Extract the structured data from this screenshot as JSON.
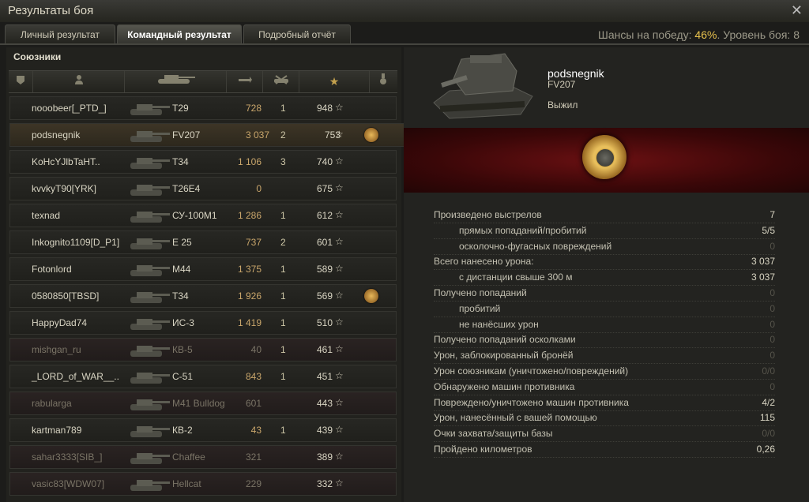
{
  "window": {
    "title": "Результаты боя"
  },
  "tabs": [
    {
      "label": "Личный результат"
    },
    {
      "label": "Командный результат"
    },
    {
      "label": "Подробный отчёт"
    }
  ],
  "header": {
    "chances_label": "Шансы на победу:",
    "chances_value": "46%",
    "level_label": ". Уровень боя: 8"
  },
  "team": {
    "title": "Союзники",
    "rows": [
      {
        "name": "nooobeer[_PTD_]",
        "vehicle": "T29",
        "damage": "728",
        "kills": "1",
        "xp": "948",
        "medal": false,
        "state": "alive"
      },
      {
        "name": "podsnegnik",
        "vehicle": "FV207",
        "damage": "3 037",
        "kills": "2",
        "xp": "753",
        "medal": true,
        "state": "me"
      },
      {
        "name": "KoHcYJlbTaHT..",
        "vehicle": "T34",
        "damage": "1 106",
        "kills": "3",
        "xp": "740",
        "medal": false,
        "state": "alive"
      },
      {
        "name": "kvvkyT90[YRK]",
        "vehicle": "T26E4",
        "damage": "0",
        "kills": "",
        "xp": "675",
        "medal": false,
        "state": "alive"
      },
      {
        "name": "texnad",
        "vehicle": "СУ-100М1",
        "damage": "1 286",
        "kills": "1",
        "xp": "612",
        "medal": false,
        "state": "alive"
      },
      {
        "name": "Inkognito1109[D_P1]",
        "vehicle": "E 25",
        "damage": "737",
        "kills": "2",
        "xp": "601",
        "medal": false,
        "state": "alive"
      },
      {
        "name": "Fotonlord",
        "vehicle": "M44",
        "damage": "1 375",
        "kills": "1",
        "xp": "589",
        "medal": false,
        "state": "alive"
      },
      {
        "name": "0580850[TBSD]",
        "vehicle": "T34",
        "damage": "1 926",
        "kills": "1",
        "xp": "569",
        "medal": true,
        "state": "alive"
      },
      {
        "name": "HappyDad74",
        "vehicle": "ИС-3",
        "damage": "1 419",
        "kills": "1",
        "xp": "510",
        "medal": false,
        "state": "alive"
      },
      {
        "name": "mishgan_ru",
        "vehicle": "КВ-5",
        "damage": "40",
        "kills": "1",
        "xp": "461",
        "medal": false,
        "state": "dead"
      },
      {
        "name": "_LORD_of_WAR__..",
        "vehicle": "С-51",
        "damage": "843",
        "kills": "1",
        "xp": "451",
        "medal": false,
        "state": "alive"
      },
      {
        "name": "rabularga",
        "vehicle": "M41 Bulldog",
        "damage": "601",
        "kills": "",
        "xp": "443",
        "medal": false,
        "state": "dead"
      },
      {
        "name": "kartman789",
        "vehicle": "КВ-2",
        "damage": "43",
        "kills": "1",
        "xp": "439",
        "medal": false,
        "state": "alive"
      },
      {
        "name": "sahar3333[SIB_]",
        "vehicle": "Chaffee",
        "damage": "321",
        "kills": "",
        "xp": "389",
        "medal": false,
        "state": "dead"
      },
      {
        "name": "vasic83[WDW07]",
        "vehicle": "Hellcat",
        "damage": "229",
        "kills": "",
        "xp": "332",
        "medal": false,
        "state": "dead"
      }
    ]
  },
  "player": {
    "name": "podsnegnik",
    "vehicle": "FV207",
    "status": "Выжил"
  },
  "stats": [
    {
      "label": "Произведено выстрелов",
      "value": "7",
      "sub": false,
      "zero": false
    },
    {
      "label": "прямых попаданий/пробитий",
      "value": "5/5",
      "sub": true,
      "zero": false
    },
    {
      "label": "осколочно-фугасных повреждений",
      "value": "0",
      "sub": true,
      "zero": true
    },
    {
      "label": "Всего нанесено урона:",
      "value": "3 037",
      "sub": false,
      "zero": false
    },
    {
      "label": "с дистанции свыше 300 м",
      "value": "3 037",
      "sub": true,
      "zero": false
    },
    {
      "label": "Получено попаданий",
      "value": "0",
      "sub": false,
      "zero": true
    },
    {
      "label": "пробитий",
      "value": "0",
      "sub": true,
      "zero": true
    },
    {
      "label": "не нанёсших урон",
      "value": "0",
      "sub": true,
      "zero": true
    },
    {
      "label": "Получено попаданий осколками",
      "value": "0",
      "sub": false,
      "zero": true
    },
    {
      "label": "Урон, заблокированный бронёй",
      "value": "0",
      "sub": false,
      "zero": true
    },
    {
      "label": "Урон союзникам (уничтожено/повреждений)",
      "value": "0/0",
      "sub": false,
      "zero": true
    },
    {
      "label": "Обнаружено машин противника",
      "value": "0",
      "sub": false,
      "zero": true
    },
    {
      "label": "Повреждено/уничтожено машин противника",
      "value": "4/2",
      "sub": false,
      "zero": false
    },
    {
      "label": "Урон, нанесённый с вашей помощью",
      "value": "115",
      "sub": false,
      "zero": false
    },
    {
      "label": "Очки захвата/защиты базы",
      "value": "0/0",
      "sub": false,
      "zero": true
    },
    {
      "label": "Пройдено километров",
      "value": "0,26",
      "sub": false,
      "zero": false
    }
  ],
  "icons": {
    "close": "close-icon",
    "star": "star-icon",
    "medal": "medal-icon"
  }
}
